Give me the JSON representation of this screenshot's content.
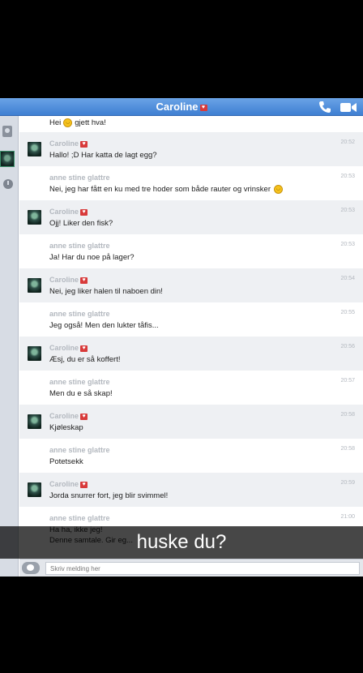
{
  "header": {
    "title": "Caroline",
    "title_heart": "♥"
  },
  "icons": {
    "phone": "phone-icon",
    "video": "video-camera-icon",
    "contacts": "contacts-icon",
    "history": "clock-icon",
    "emoji": "emoji-icon"
  },
  "colors": {
    "header": "#4a8ad9",
    "row_grey": "#eef0f3",
    "heart": "#d83a3a"
  },
  "messages": [
    {
      "sender": "",
      "time": "",
      "text": "Hei",
      "text_after": "gjett hva!",
      "smiley": true,
      "own": false,
      "first": true
    },
    {
      "sender": "Caroline",
      "heart": "♥",
      "time": "20:52",
      "text": "Hallo! ;D Har katta de lagt egg?",
      "own": false
    },
    {
      "sender": "anne stine glattre",
      "time": "20:53",
      "text": "Nei, jeg har fått en ku med tre hoder som både rauter og vrinsker",
      "smiley_end": true,
      "own": true
    },
    {
      "sender": "Caroline",
      "heart": "♥",
      "time": "20:53",
      "text": "Ojj! Liker den fisk?",
      "own": false
    },
    {
      "sender": "anne stine glattre",
      "time": "20:53",
      "text": "Ja! Har du noe på lager?",
      "own": true
    },
    {
      "sender": "Caroline",
      "heart": "♥",
      "time": "20:54",
      "text": "Nei, jeg liker halen til naboen din!",
      "own": false
    },
    {
      "sender": "anne stine glattre",
      "time": "20:55",
      "text": "Jeg også! Men den lukter tåfis...",
      "own": true
    },
    {
      "sender": "Caroline",
      "heart": "♥",
      "time": "20:56",
      "text": "Æsj, du er så koffert!",
      "own": false
    },
    {
      "sender": "anne stine glattre",
      "time": "20:57",
      "text": "Men du e så skap!",
      "own": true
    },
    {
      "sender": "Caroline",
      "heart": "♥",
      "time": "20:58",
      "text": "Kjøleskap",
      "own": false
    },
    {
      "sender": "anne stine glattre",
      "time": "20:58",
      "text": "Potetsekk",
      "own": true
    },
    {
      "sender": "Caroline",
      "heart": "♥",
      "time": "20:59",
      "text": "Jorda snurrer fort, jeg blir svimmel!",
      "own": false
    },
    {
      "sender": "anne stine glattre",
      "time": "21:00",
      "text": "Ha ha, ikke jeg!",
      "text2": "Denne samtale. Gir eg...",
      "own": true
    }
  ],
  "input": {
    "placeholder": "Skriv melding her"
  },
  "caption": "huske du?"
}
